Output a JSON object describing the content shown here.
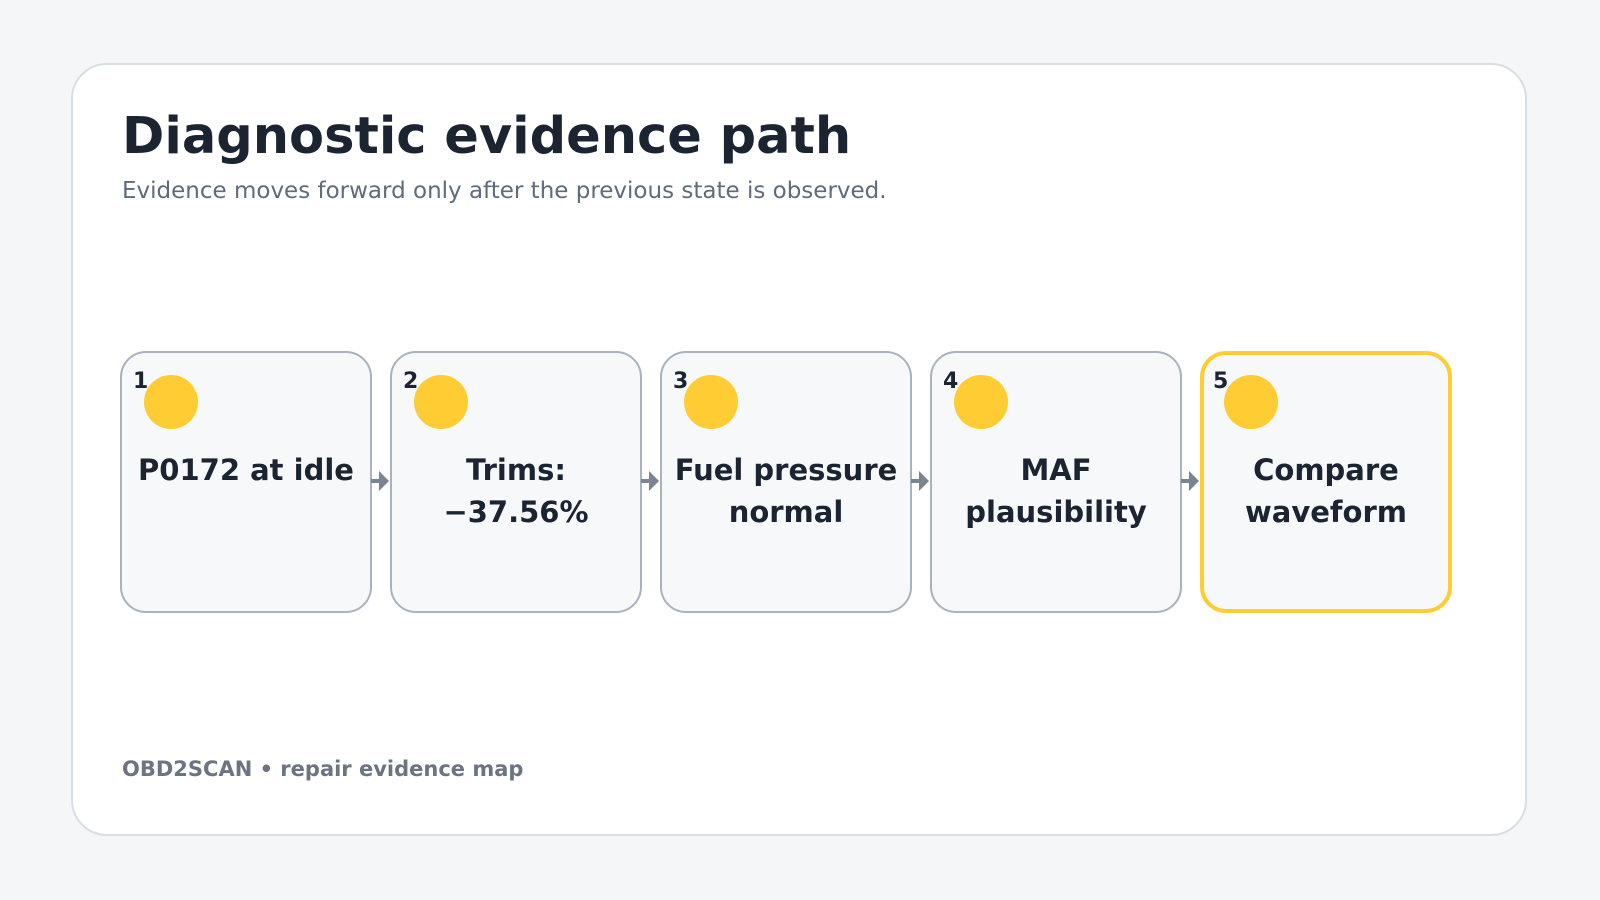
{
  "header": {
    "title": "Diagnostic evidence path",
    "subtitle": "Evidence moves forward only after the previous state is observed."
  },
  "steps": [
    {
      "number": "1",
      "label": "P0172 at idle"
    },
    {
      "number": "2",
      "label": "Trims: −37.56%"
    },
    {
      "number": "3",
      "label": "Fuel pressure normal"
    },
    {
      "number": "4",
      "label": "MAF plausibility"
    },
    {
      "number": "5",
      "label": "Compare waveform"
    }
  ],
  "footer": {
    "text": "OBD2SCAN • repair evidence map"
  },
  "colors": {
    "accent": "#ffcd33",
    "text": "#1b2430",
    "muted": "#5f6b7a",
    "step_border": "#aab2bd",
    "arrow": "#7b8591"
  }
}
